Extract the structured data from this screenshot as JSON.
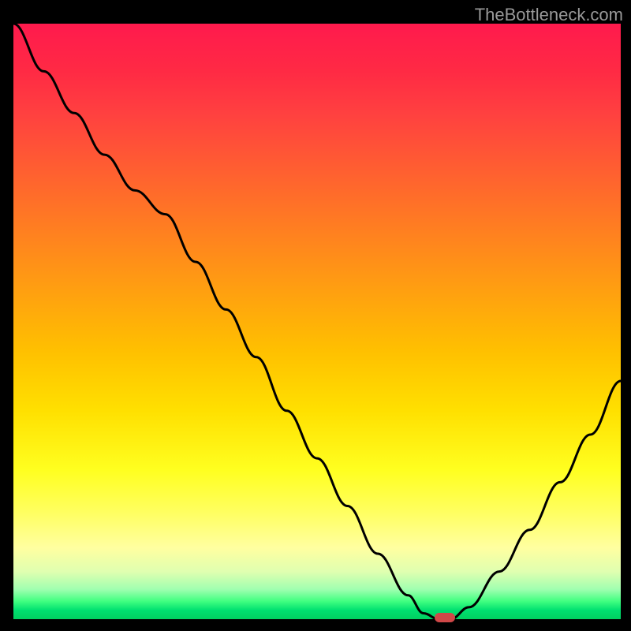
{
  "watermark": "TheBottleneck.com",
  "chart_data": {
    "type": "line",
    "title": "",
    "xlabel": "",
    "ylabel": "",
    "x": [
      0.0,
      0.05,
      0.1,
      0.15,
      0.2,
      0.25,
      0.3,
      0.35,
      0.4,
      0.45,
      0.5,
      0.55,
      0.6,
      0.65,
      0.675,
      0.7,
      0.72,
      0.75,
      0.8,
      0.85,
      0.9,
      0.95,
      1.0
    ],
    "values": [
      100,
      92,
      85,
      78,
      72,
      68,
      60,
      52,
      44,
      35,
      27,
      19,
      11,
      4,
      1,
      0,
      0,
      2,
      8,
      15,
      23,
      31,
      40
    ],
    "ylim": [
      0,
      100
    ],
    "xlim": [
      0,
      1
    ],
    "marker_x": 0.71,
    "marker_y": 0,
    "gradient_colors": {
      "top": "#ff1a4d",
      "mid_upper": "#ff8020",
      "mid": "#ffe000",
      "mid_lower": "#ffff60",
      "bottom": "#00d060"
    }
  }
}
